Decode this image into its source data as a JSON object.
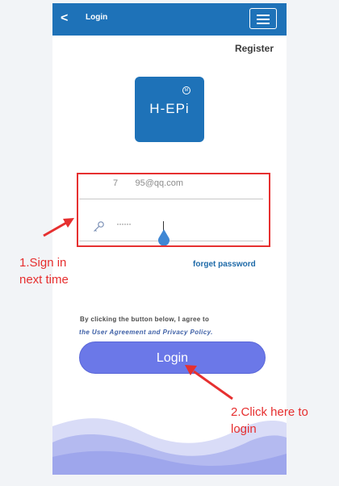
{
  "header": {
    "back_label": "<",
    "title": "Login",
    "menu_icon": "hamburger-icon"
  },
  "register_label": "Register",
  "logo": {
    "text": "H-EPi",
    "badge": "M"
  },
  "form": {
    "email_value": "7       95@qq.com",
    "password_value": "······",
    "password_icon": "key-icon",
    "forget_label": "forget password"
  },
  "agreement": {
    "line1": "By clicking the button below, I agree to",
    "line2": "the User Agreement and Privacy Policy."
  },
  "login_button_label": "Login",
  "annotations": {
    "step1": [
      "1.Sign in",
      "next time"
    ],
    "step2": [
      "2.Click here to",
      "login"
    ]
  },
  "colors": {
    "brand_blue": "#1e72b8",
    "button": "#6b78e8",
    "annotation_red": "#e63030"
  }
}
